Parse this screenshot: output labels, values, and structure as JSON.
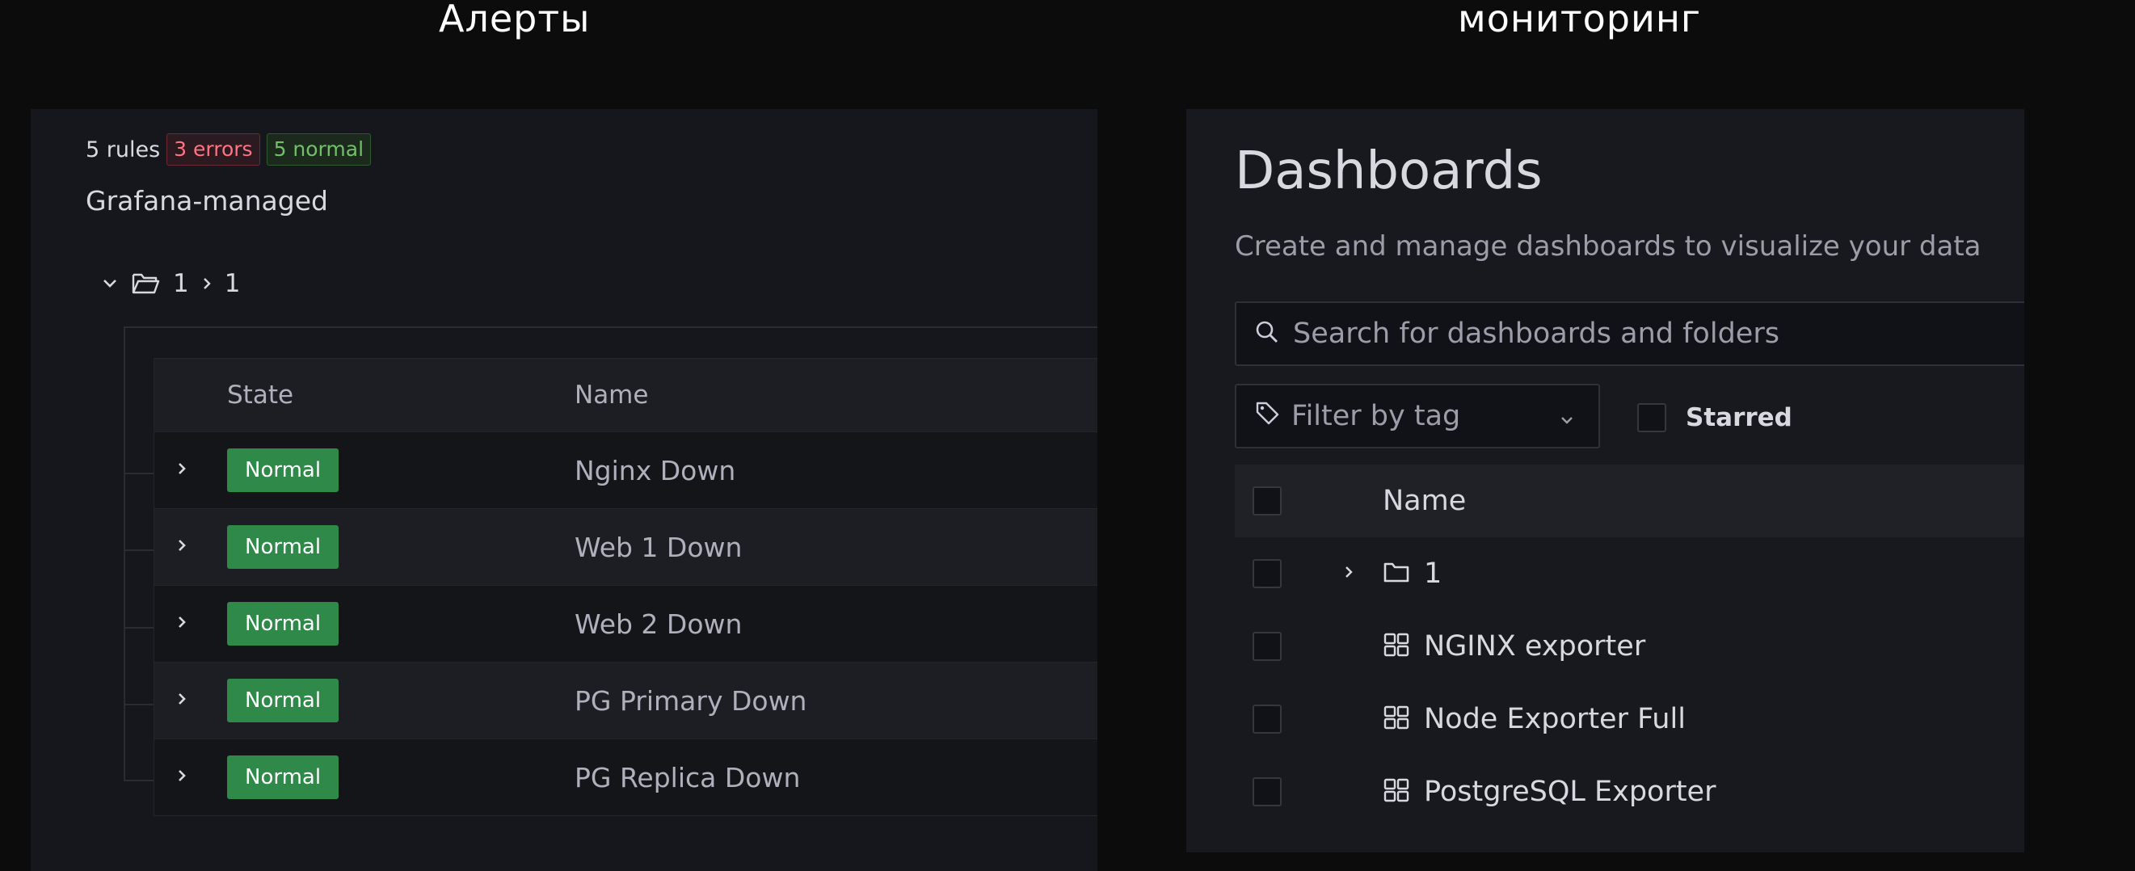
{
  "captions": {
    "left": "Алерты",
    "right": "мониторинг"
  },
  "alerts": {
    "rule_count": "5 rules",
    "errors_badge": "3 errors",
    "normal_badge": "5 normal",
    "group_title": "Grafana-managed",
    "folder_path": [
      "1",
      "1"
    ],
    "columns": {
      "state": "State",
      "name": "Name"
    },
    "rows": [
      {
        "state": "Normal",
        "name": "Nginx Down"
      },
      {
        "state": "Normal",
        "name": "Web 1 Down"
      },
      {
        "state": "Normal",
        "name": "Web 2 Down"
      },
      {
        "state": "Normal",
        "name": "PG Primary Down"
      },
      {
        "state": "Normal",
        "name": "PG Replica Down"
      }
    ],
    "colors": {
      "error": "#ff7383",
      "normal": "#73bf69",
      "state_bg": "#2f8a49"
    }
  },
  "dashboards": {
    "title": "Dashboards",
    "subtitle": "Create and manage dashboards to visualize your data",
    "search_placeholder": "Search for dashboards and folders",
    "tag_filter": "Filter by tag",
    "starred_label": "Starred",
    "column_name": "Name",
    "items": [
      {
        "type": "folder",
        "label": "1",
        "icon": "folder-icon"
      },
      {
        "type": "dashboard",
        "label": "NGINX exporter",
        "icon": "dashboard-grid-icon"
      },
      {
        "type": "dashboard",
        "label": "Node Exporter Full",
        "icon": "dashboard-grid-icon"
      },
      {
        "type": "dashboard",
        "label": "PostgreSQL Exporter",
        "icon": "dashboard-grid-icon"
      }
    ]
  }
}
